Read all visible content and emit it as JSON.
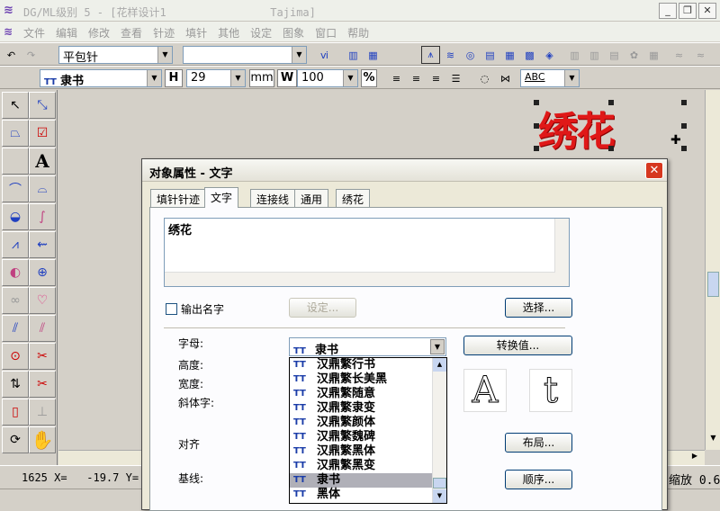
{
  "window": {
    "title": "DG/ML级别 5 - [花样设计1                Tajima]",
    "min": "_",
    "restore": "❐",
    "close": "✕"
  },
  "menu": [
    "文件",
    "编辑",
    "修改",
    "查看",
    "针迹",
    "填针",
    "其他",
    "设定",
    "图象",
    "窗口",
    "帮助"
  ],
  "toolbar1": {
    "stitch_type": "平包针",
    "second_combo": ""
  },
  "toolbar2": {
    "font": "隶书",
    "h_label": "H",
    "height": "29",
    "mm": "mm",
    "w_label": "W",
    "width": "100",
    "pct": "%",
    "abc": "ABC"
  },
  "status": {
    "coords": "1625 X=   -19.7 Y=",
    "zoom": "缩放 0.6"
  },
  "embroidery_text": "绣花",
  "dialog": {
    "title": "对象属性 - 文字",
    "close": "✕",
    "tabs": [
      "填针针迹",
      "文字",
      "连接线",
      "通用",
      "绣花"
    ],
    "text_value": "绣花",
    "output_name_label": "输出名字",
    "settings_btn": "设定...",
    "select_btn": "选择...",
    "font_label": "字母:",
    "height_label": "高度:",
    "width_label": "宽度:",
    "italic_label": "斜体字:",
    "align_label": "对齐",
    "baseline_label": "基线:",
    "font_value": "隶书",
    "convert_btn": "转换值...",
    "layout_btn": "布局...",
    "order_btn": "顺序...",
    "fonts": [
      "汉鼎繁行书",
      "汉鼎繁长美黑",
      "汉鼎繁随意",
      "汉鼎繁隶变",
      "汉鼎繁颜体",
      "汉鼎繁魏碑",
      "汉鼎繁黑体",
      "汉鼎繁黑变",
      "隶书",
      "黑体"
    ],
    "selected_font": "隶书",
    "preview_upper": "A",
    "preview_lower": "t"
  }
}
